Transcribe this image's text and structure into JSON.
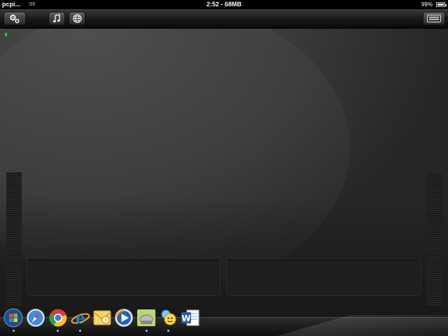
{
  "status": {
    "carrier": "pcpi...",
    "signal": "-59",
    "center": "2:52 - 68MB",
    "battery": "99%"
  },
  "toolbar": {
    "buttons": [
      {
        "name": "settings",
        "icon": "gear-icon"
      },
      {
        "name": "media",
        "icon": "music-note-icon"
      },
      {
        "name": "web",
        "icon": "globe-icon"
      },
      {
        "name": "keyboard",
        "icon": "keyboard-icon"
      }
    ]
  },
  "dock": {
    "icons": [
      "windows-start-icon",
      "safari-icon",
      "chrome-icon",
      "internet-explorer-icon",
      "outlook-icon",
      "windows-media-player-icon",
      "app-icon",
      "messenger-icon",
      "word-icon"
    ]
  },
  "colors": {
    "toolbar": "#171717",
    "background": "#2e2e2e",
    "cursor": "#33cc33"
  }
}
